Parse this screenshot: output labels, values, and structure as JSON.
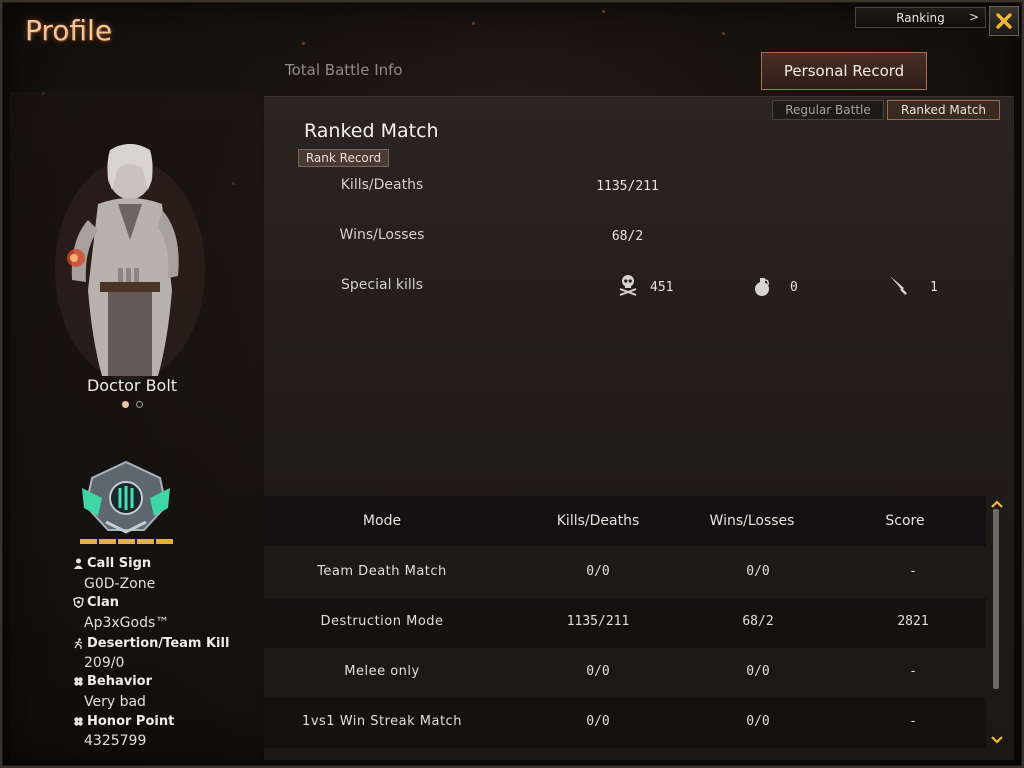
{
  "window": {
    "title": "Profile"
  },
  "header": {
    "ranking_label": "Ranking",
    "ranking_chevron": ">",
    "tabs": {
      "total": "Total Battle Info",
      "personal": "Personal Record"
    }
  },
  "character": {
    "name": "Doctor Bolt"
  },
  "profile": {
    "call_sign_label": "Call Sign",
    "call_sign": "G0D-Zone",
    "clan_label": "Clan",
    "clan": "Ap3xGods™",
    "desertion_label": "Desertion/Team Kill",
    "desertion": "209/0",
    "behavior_label": "Behavior",
    "behavior": "Very bad",
    "honor_label": "Honor Point",
    "honor": "4325799",
    "rank_bars": 5
  },
  "subtabs": {
    "regular": "Regular Battle",
    "ranked": "Ranked Match"
  },
  "record": {
    "title": "Ranked Match",
    "rank_record_btn": "Rank Record",
    "kd_label": "Kills/Deaths",
    "kd_value": "1135/211",
    "wl_label": "Wins/Losses",
    "wl_value": "68/2",
    "special_label": "Special kills",
    "special": {
      "headshot": "451",
      "grenade": "0",
      "knife": "1"
    }
  },
  "table": {
    "headers": {
      "mode": "Mode",
      "kd": "Kills/Deaths",
      "wl": "Wins/Losses",
      "score": "Score"
    },
    "rows": [
      {
        "mode": "Team Death Match",
        "kd": "0/0",
        "wl": "0/0",
        "score": "-"
      },
      {
        "mode": "Destruction Mode",
        "kd": "1135/211",
        "wl": "68/2",
        "score": "2821"
      },
      {
        "mode": "Melee only",
        "kd": "0/0",
        "wl": "0/0",
        "score": "-"
      },
      {
        "mode": "1vs1 Win Streak Match",
        "kd": "0/0",
        "wl": "0/0",
        "score": "-"
      }
    ]
  },
  "colors": {
    "accent": "#b06a4e",
    "title": "#f1c69a",
    "rank_bar": "#e4b333"
  }
}
